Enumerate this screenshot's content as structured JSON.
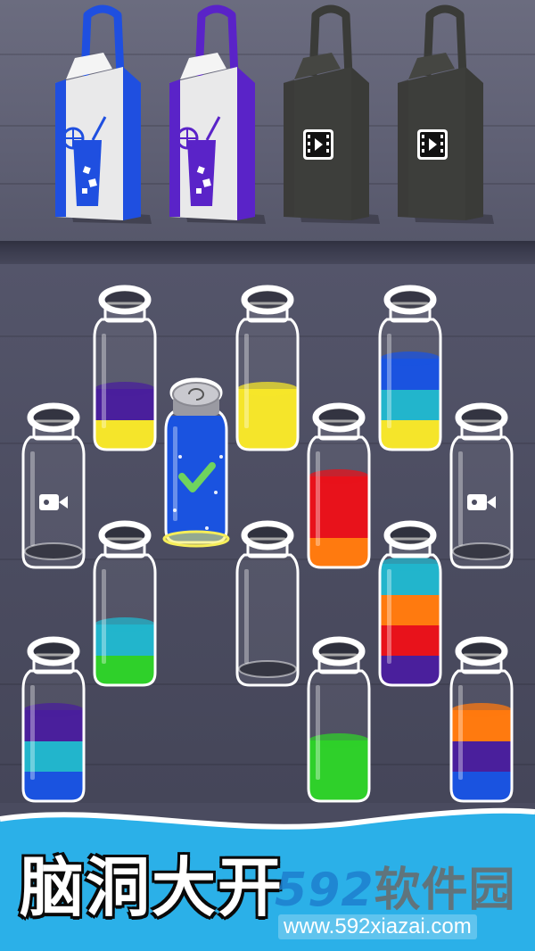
{
  "shelf": {
    "bags": [
      {
        "name": "bag-blue",
        "state": "unlocked",
        "color": "#1f4fe0",
        "icon": "lemonade-icon"
      },
      {
        "name": "bag-purple",
        "state": "unlocked",
        "color": "#5a23c8",
        "icon": "lemonade-icon"
      },
      {
        "name": "bag-locked-1",
        "state": "locked",
        "color": "#3a3b38",
        "icon": "video-icon"
      },
      {
        "name": "bag-locked-2",
        "state": "locked",
        "color": "#3a3b38",
        "icon": "video-icon"
      }
    ]
  },
  "bottles": [
    {
      "id": "b1",
      "layers": [
        "#f5e52a",
        "#4a1f9c"
      ],
      "state": "normal"
    },
    {
      "id": "b2",
      "layers": [
        "#1a53e0",
        "#1a53e0",
        "#1a53e0",
        "#1a53e0"
      ],
      "state": "completed"
    },
    {
      "id": "b3",
      "layers": [
        "#f5e52a",
        "#f5e52a"
      ],
      "state": "normal"
    },
    {
      "id": "b4",
      "layers": [
        "#f5e52a",
        "#22b5cc",
        "#1a53e0"
      ],
      "state": "normal"
    },
    {
      "id": "b5",
      "layers": [],
      "state": "locked-video"
    },
    {
      "id": "b6",
      "layers": [
        "#ff7a0f",
        "#e8121b",
        "#e8121b"
      ],
      "state": "normal"
    },
    {
      "id": "b7",
      "layers": [],
      "state": "locked-video"
    },
    {
      "id": "b8",
      "layers": [
        "#2fd02a",
        "#22b5cc"
      ],
      "state": "normal"
    },
    {
      "id": "b9",
      "layers": [],
      "state": "normal"
    },
    {
      "id": "b10",
      "layers": [
        "#4a1f9c",
        "#e8121b",
        "#ff7a0f",
        "#22b5cc"
      ],
      "state": "normal"
    },
    {
      "id": "b11",
      "layers": [
        "#1a53e0",
        "#22b5cc",
        "#4a1f9c"
      ],
      "state": "normal"
    },
    {
      "id": "b12",
      "layers": [
        "#2fd02a",
        "#2fd02a"
      ],
      "state": "normal"
    },
    {
      "id": "b13",
      "layers": [
        "#1a53e0",
        "#4a1f9c",
        "#ff7a0f"
      ],
      "state": "normal"
    }
  ],
  "banner": {
    "title": "脑洞大开",
    "watermark_logo_num": "592",
    "watermark_logo_text": "软件园",
    "watermark_url": "www.592xiazai.com"
  }
}
